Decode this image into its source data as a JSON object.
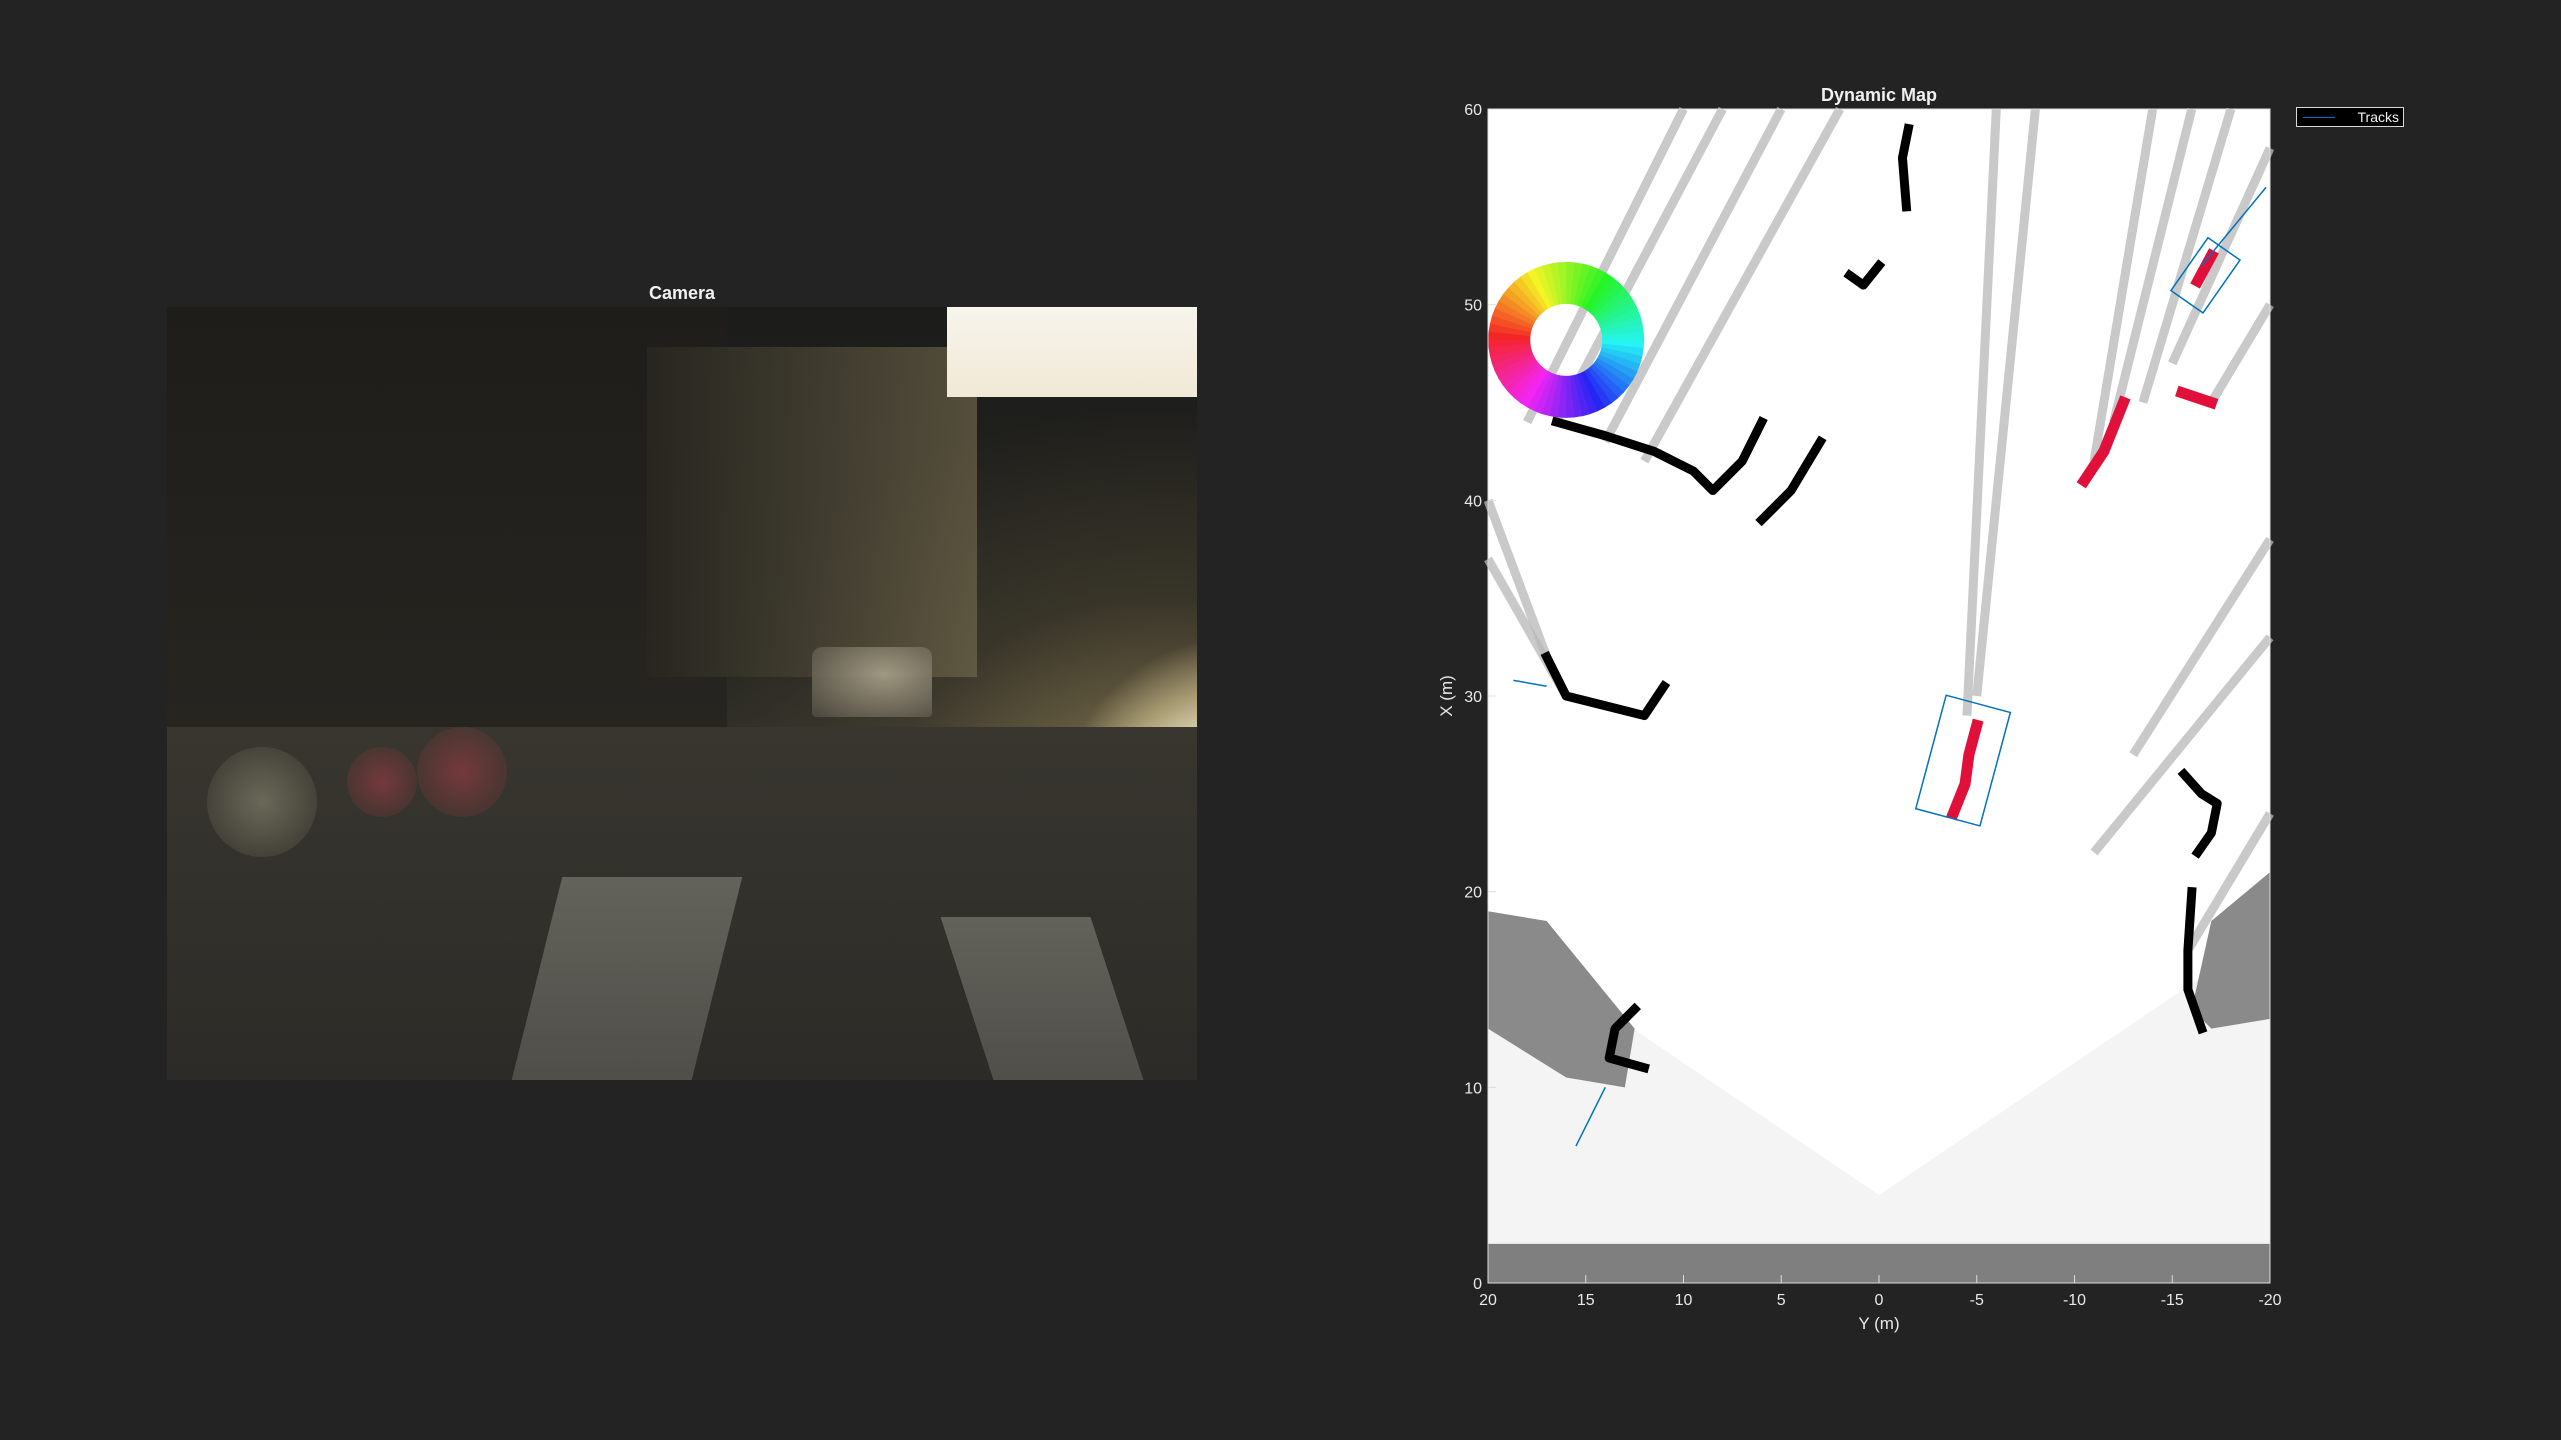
{
  "camera": {
    "title": "Camera"
  },
  "chart_data": {
    "type": "heatmap",
    "title": "Dynamic Map",
    "xlabel": "Y (m)",
    "ylabel": "X (m)",
    "xlim": [
      20,
      -20
    ],
    "ylim": [
      0,
      60
    ],
    "xticks": [
      20,
      15,
      10,
      5,
      0,
      -5,
      -10,
      -15,
      -20
    ],
    "yticks": [
      0,
      10,
      20,
      30,
      40,
      50,
      60
    ],
    "xtick_labels": [
      "20",
      "15",
      "10",
      "5",
      "0",
      "-5",
      "-10",
      "-15",
      "-20"
    ],
    "ytick_labels": [
      "0",
      "10",
      "20",
      "30",
      "40",
      "50",
      "60"
    ],
    "legend": {
      "entries": [
        "Tracks"
      ],
      "placement": "outside-top-right"
    },
    "colors": {
      "free": "#ffffff",
      "unknown": "#f4f4f4",
      "occupied": "#000000",
      "dynamic": "#e0103a",
      "track": "#0072bd",
      "ego_band": "#7f7f7f"
    },
    "tracks": [
      {
        "center": [
          -4.3,
          26.7
        ],
        "length": 6.0,
        "width": 3.4,
        "heading_deg": 75
      },
      {
        "center": [
          -16.7,
          51.5
        ],
        "length": 3.3,
        "width": 2.0,
        "heading_deg": 55
      }
    ],
    "track_lines": [
      {
        "from": [
          15.5,
          7
        ],
        "to": [
          14,
          10
        ]
      },
      {
        "from": [
          -16.5,
          52
        ],
        "to": [
          -19.8,
          56
        ]
      },
      {
        "from": [
          18.7,
          30.8
        ],
        "to": [
          17,
          30.5
        ]
      }
    ],
    "occupied_features": [
      {
        "points": [
          [
            16.5,
            44
          ],
          [
            14,
            43.3
          ],
          [
            11.5,
            42.5
          ],
          [
            9.5,
            41.5
          ],
          [
            8.5,
            40.5
          ],
          [
            7,
            42
          ],
          [
            6,
            44
          ]
        ]
      },
      {
        "points": [
          [
            6,
            39
          ],
          [
            4.5,
            40.5
          ],
          [
            3,
            43
          ]
        ]
      },
      {
        "points": [
          [
            17,
            32
          ],
          [
            16,
            30
          ],
          [
            14,
            29.5
          ],
          [
            12,
            29
          ],
          [
            11,
            30.5
          ]
        ]
      },
      {
        "points": [
          [
            12.5,
            14
          ],
          [
            13.5,
            13
          ],
          [
            13.8,
            11.5
          ],
          [
            12,
            11
          ]
        ]
      },
      {
        "points": [
          [
            -15.6,
            26
          ],
          [
            -16.5,
            25
          ],
          [
            -17.3,
            24.5
          ],
          [
            -17,
            23
          ],
          [
            -16.3,
            22
          ]
        ]
      },
      {
        "points": [
          [
            -16,
            20
          ],
          [
            -15.8,
            17
          ],
          [
            -15.8,
            15
          ],
          [
            -16.5,
            13
          ]
        ]
      },
      {
        "points": [
          [
            -1.4,
            55
          ],
          [
            -1.2,
            57.5
          ],
          [
            -1.5,
            59
          ]
        ]
      },
      {
        "points": [
          [
            0,
            52
          ],
          [
            0.8,
            51
          ],
          [
            1.5,
            51.5
          ]
        ]
      }
    ],
    "dynamic_features": [
      {
        "points": [
          [
            -3.8,
            24
          ],
          [
            -4.4,
            25.5
          ],
          [
            -4.6,
            27
          ],
          [
            -5,
            28.5
          ]
        ]
      },
      {
        "points": [
          [
            -10.5,
            41
          ],
          [
            -11.5,
            42.5
          ],
          [
            -12.5,
            45
          ]
        ]
      },
      {
        "points": [
          [
            -15.5,
            45.5
          ],
          [
            -17,
            45
          ]
        ]
      },
      {
        "points": [
          [
            -16.3,
            51.2
          ],
          [
            -17,
            52.5
          ]
        ]
      }
    ],
    "legend_title": "Tracks"
  }
}
